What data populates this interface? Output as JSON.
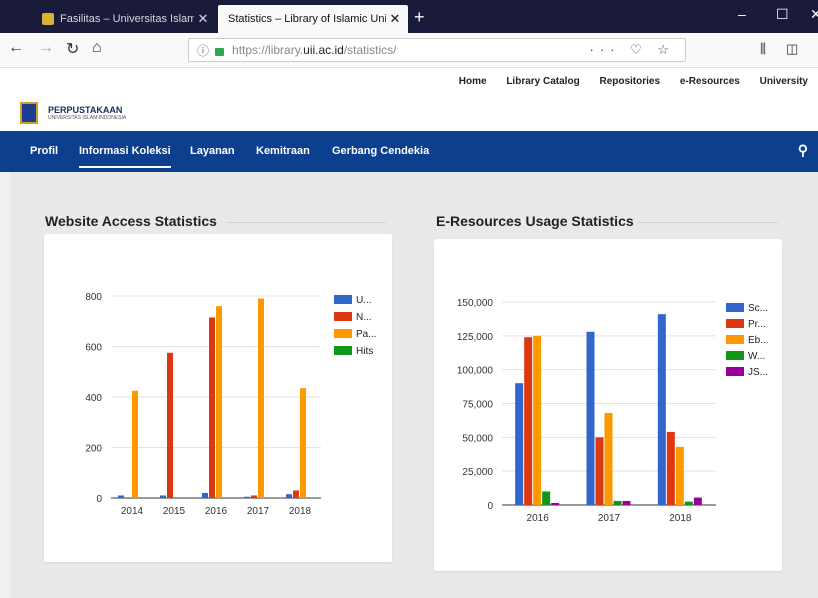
{
  "browser": {
    "tabs": [
      {
        "label": "Fasilitas – Universitas Islam Ind",
        "close": "✕"
      },
      {
        "label": "Statistics – Library of Islamic Unive",
        "close": "✕"
      }
    ],
    "new_tab": "+",
    "window_controls": [
      "–",
      "☐",
      "✕"
    ],
    "url_scheme": "https://library.",
    "url_domain": "uii.ac.id",
    "url_path": "/statistics/",
    "url_icons": "··· ♡ ☆"
  },
  "site": {
    "top_links": [
      "Home",
      "Library Catalog",
      "Repositories",
      "e-Resources",
      "University"
    ],
    "logo_title": "PERPUSTAKAAN",
    "logo_subtitle": "UNIVERSITAS ISLAM INDONESIA",
    "menu": [
      "Profil",
      "Informasi Koleksi",
      "Layanan",
      "Kemitraan",
      "Gerbang Cendekia"
    ]
  },
  "sections": {
    "website_title": "Website Access Statistics",
    "eresources_title": "E-Resources Usage Statistics"
  },
  "colors": {
    "blue": "#3366cc",
    "red": "#dc3912",
    "orange": "#ff9900",
    "green": "#109618",
    "purple": "#990099"
  },
  "chart_data": [
    {
      "type": "bar",
      "title": "Website Access Statistics",
      "categories": [
        "2014",
        "2015",
        "2016",
        "2017",
        "2018"
      ],
      "ylim": [
        0,
        800
      ],
      "yticks": [
        0,
        200,
        400,
        600,
        800
      ],
      "grid": true,
      "legend_position": "right",
      "series": [
        {
          "name": "U...",
          "color": "#3366cc",
          "values": [
            10,
            10,
            20,
            5,
            15
          ]
        },
        {
          "name": "N...",
          "color": "#dc3912",
          "values": [
            0,
            575,
            715,
            10,
            30
          ]
        },
        {
          "name": "Pa...",
          "color": "#ff9900",
          "values": [
            425,
            0,
            760,
            790,
            435
          ]
        },
        {
          "name": "Hits",
          "color": "#109618",
          "values": [
            0,
            0,
            0,
            0,
            0
          ]
        }
      ]
    },
    {
      "type": "bar",
      "title": "E-Resources Usage Statistics",
      "categories": [
        "2016",
        "2017",
        "2018"
      ],
      "ylim": [
        0,
        150000
      ],
      "yticks": [
        0,
        25000,
        50000,
        75000,
        100000,
        125000,
        150000
      ],
      "ytick_labels": [
        "0",
        "25,000",
        "50,000",
        "75,000",
        "100,000",
        "125,000",
        "150,000"
      ],
      "grid": true,
      "legend_position": "right",
      "series": [
        {
          "name": "Sc...",
          "color": "#3366cc",
          "values": [
            90000,
            128000,
            141000
          ]
        },
        {
          "name": "Pr...",
          "color": "#dc3912",
          "values": [
            124000,
            50000,
            54000
          ]
        },
        {
          "name": "Eb...",
          "color": "#ff9900",
          "values": [
            125000,
            68000,
            43000
          ]
        },
        {
          "name": "W...",
          "color": "#109618",
          "values": [
            10000,
            3000,
            2500
          ]
        },
        {
          "name": "JS...",
          "color": "#990099",
          "values": [
            1500,
            3000,
            5500
          ]
        }
      ]
    }
  ]
}
